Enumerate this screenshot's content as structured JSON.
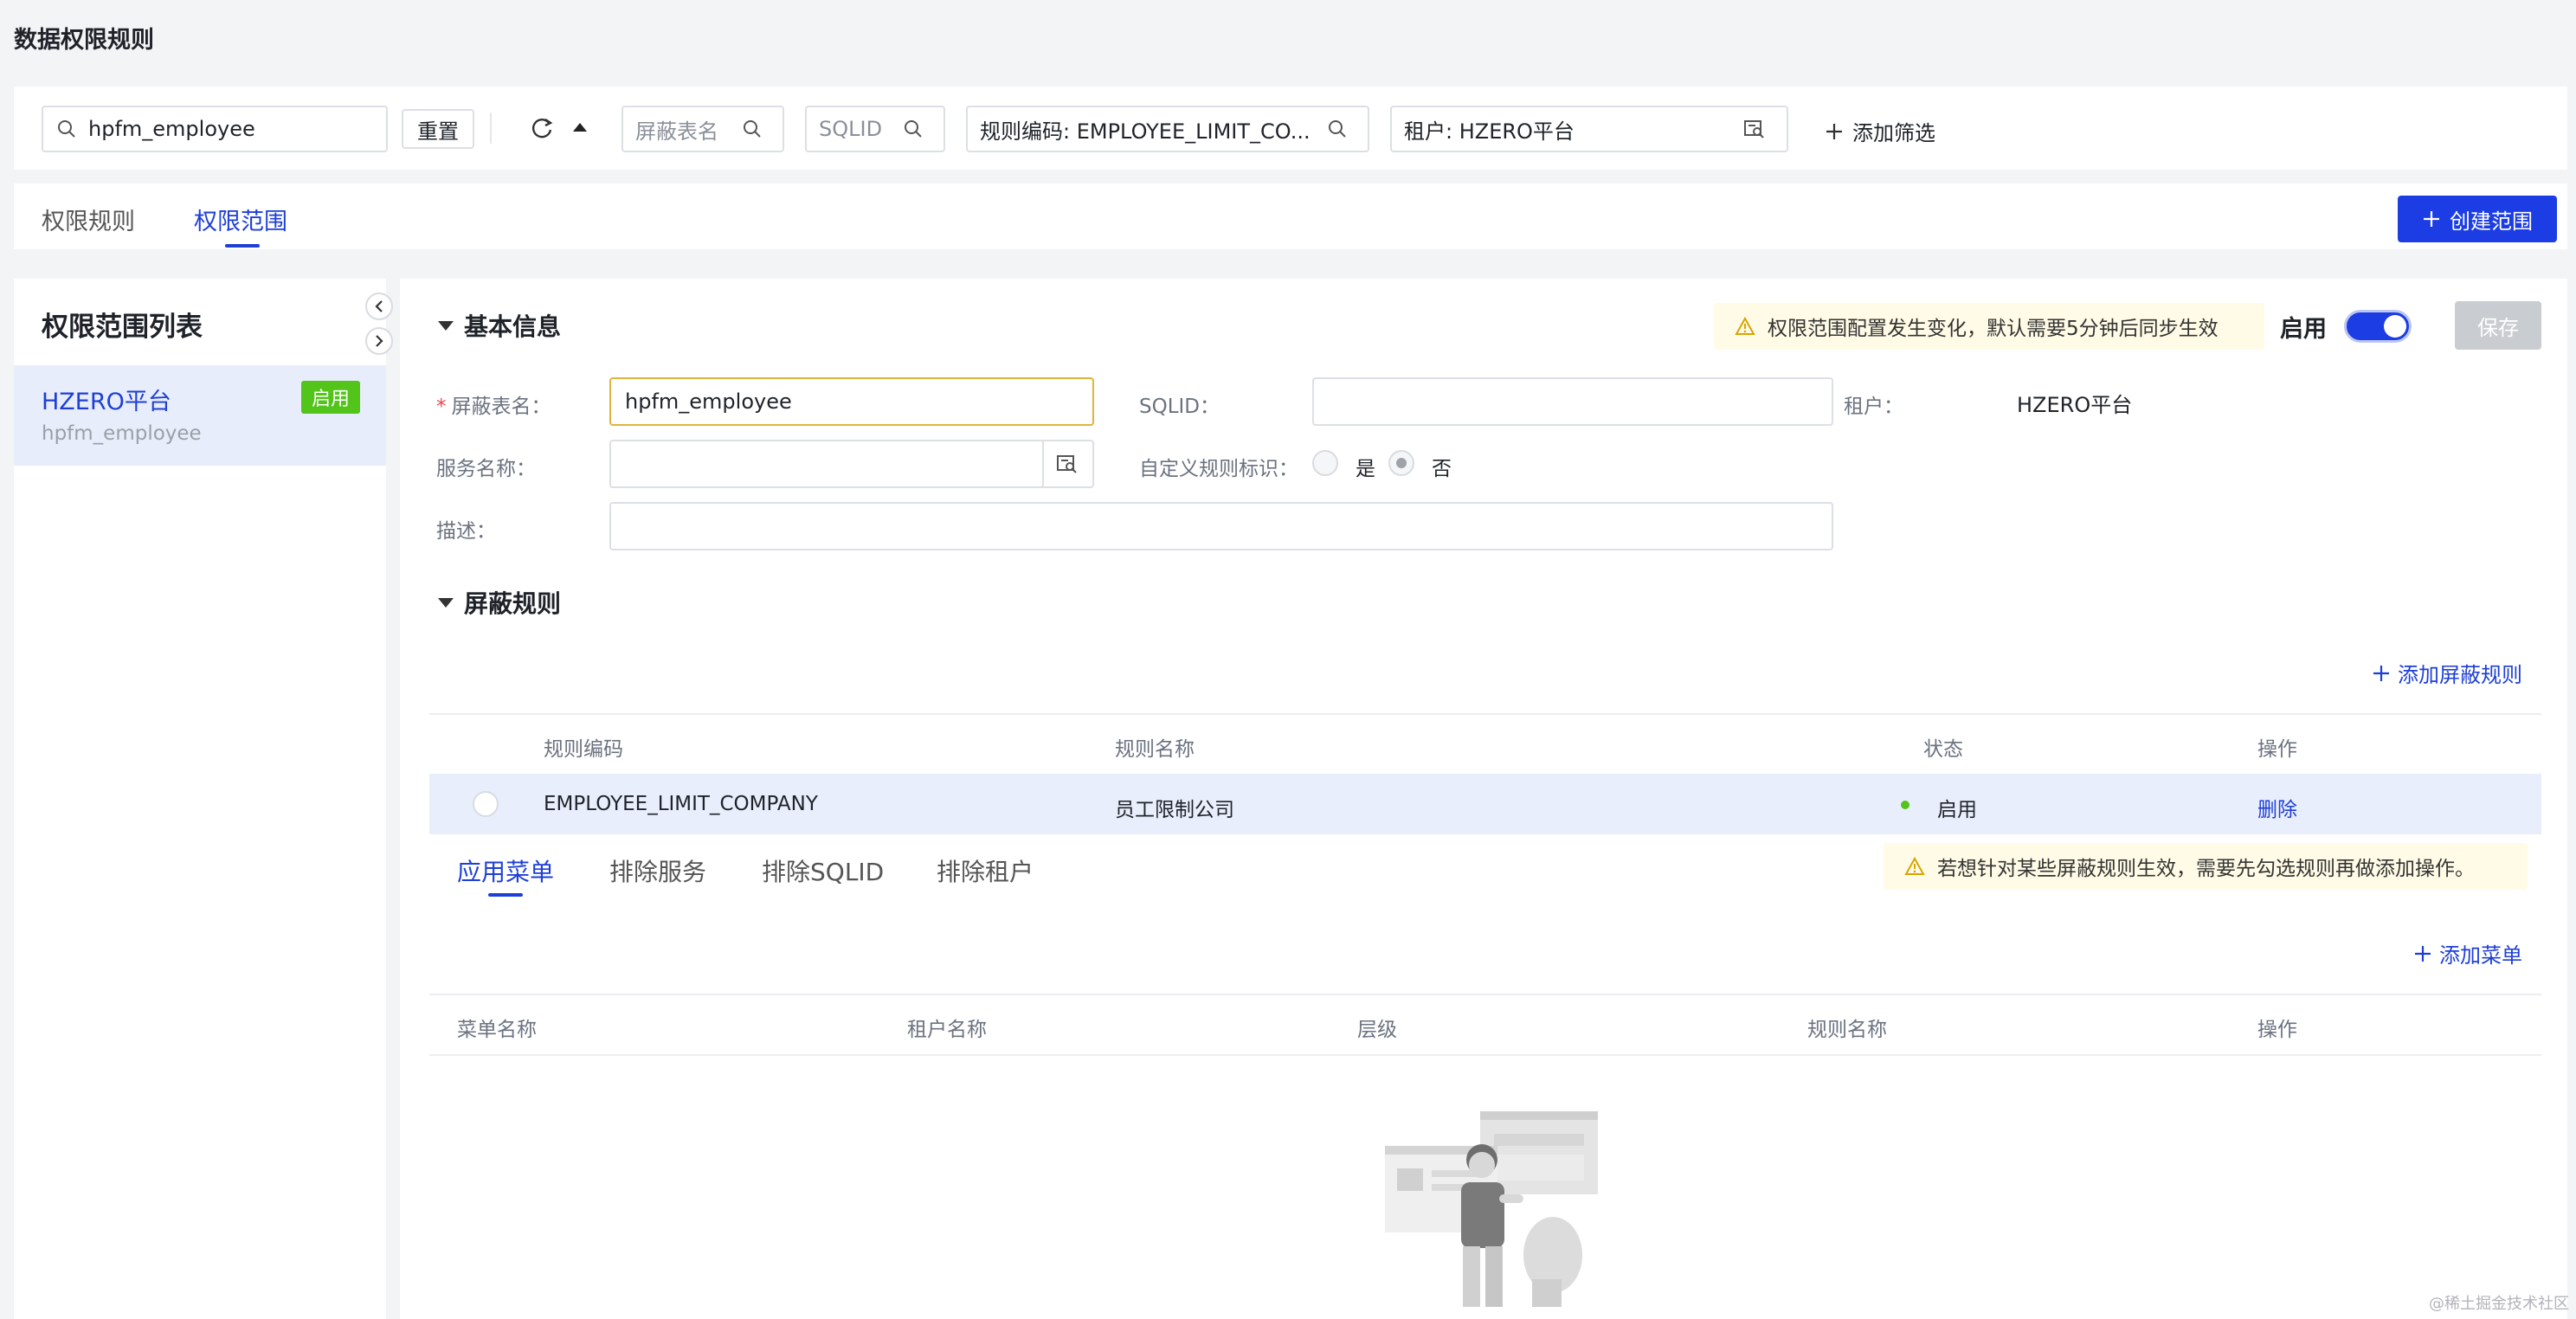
{
  "page": {
    "title": "数据权限规则"
  },
  "filter": {
    "search_value": "hpfm_employee",
    "reset_label": "重置",
    "table_placeholder": "屏蔽表名",
    "sqlid_placeholder": "SQLID",
    "rule_code_text": "规则编码: EMPLOYEE_LIMIT_CO...",
    "tenant_text": "租户: HZERO平台",
    "add_filter_label": "添加筛选"
  },
  "tabs": [
    {
      "label": "权限规则"
    },
    {
      "label": "权限范围"
    }
  ],
  "create_button_label": "创建范围",
  "left_panel": {
    "title": "权限范围列表",
    "items": [
      {
        "name": "HZERO平台",
        "sub": "hpfm_employee",
        "badge": "启用"
      }
    ]
  },
  "basic_info": {
    "title": "基本信息",
    "warning": "权限范围配置发生变化，默认需要5分钟后同步生效",
    "enable_label": "启用",
    "save_label": "保存",
    "table_name_label": "屏蔽表名：",
    "table_name_value": "hpfm_employee",
    "sqlid_label": "SQLID：",
    "sqlid_value": "",
    "tenant_label": "租户：",
    "tenant_value": "HZERO平台",
    "service_label": "服务名称：",
    "service_value": "",
    "custom_rule_label": "自定义规则标识：",
    "yes_label": "是",
    "no_label": "否",
    "desc_label": "描述：",
    "desc_value": ""
  },
  "mask_rules": {
    "title": "屏蔽规则",
    "add_label": "添加屏蔽规则",
    "columns": [
      "规则编码",
      "规则名称",
      "状态",
      "操作"
    ],
    "rows": [
      {
        "code": "EMPLOYEE_LIMIT_COMPANY",
        "name": "员工限制公司",
        "status": "启用",
        "action": "删除"
      }
    ]
  },
  "sub_tabs": [
    {
      "label": "应用菜单"
    },
    {
      "label": "排除服务"
    },
    {
      "label": "排除SQLID"
    },
    {
      "label": "排除租户"
    }
  ],
  "sub_warning": "若想针对某些屏蔽规则生效，需要先勾选规则再做添加操作。",
  "menu_table": {
    "add_label": "添加菜单",
    "columns": [
      "菜单名称",
      "租户名称",
      "层级",
      "规则名称",
      "操作"
    ]
  },
  "watermark": "@稀土掘金技术社区",
  "colors": {
    "primary": "#1b3de3",
    "success": "#52c41a",
    "warning_bg": "#fffbe6"
  }
}
